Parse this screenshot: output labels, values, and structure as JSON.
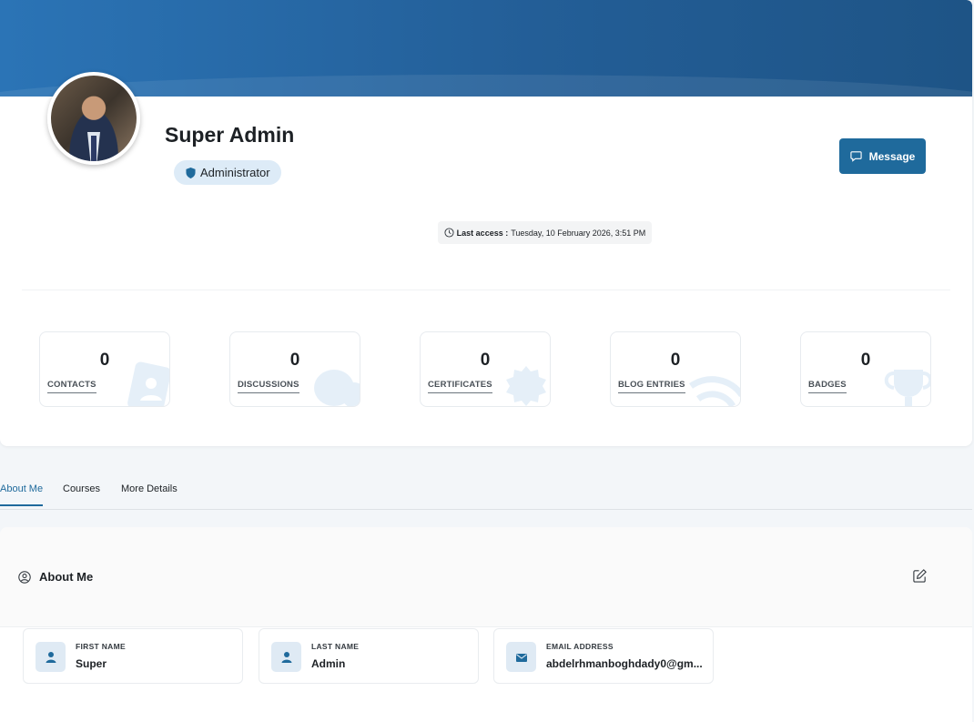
{
  "profile": {
    "name": "Super Admin",
    "role": "Administrator",
    "message_label": "Message",
    "last_access_label": "Last access :",
    "last_access_value": "Tuesday, 10 February 2026, 3:51 PM"
  },
  "stats": [
    {
      "value": "0",
      "label": "CONTACTS",
      "icon": "contacts-icon"
    },
    {
      "value": "0",
      "label": "DISCUSSIONS",
      "icon": "chat-bubbles-icon"
    },
    {
      "value": "0",
      "label": "CERTIFICATES",
      "icon": "certificate-seal-icon"
    },
    {
      "value": "0",
      "label": "BLOG ENTRIES",
      "icon": "rss-icon"
    },
    {
      "value": "0",
      "label": "BADGES",
      "icon": "trophy-icon"
    }
  ],
  "tabs": [
    {
      "label": "About Me",
      "active": true
    },
    {
      "label": "Courses",
      "active": false
    },
    {
      "label": "More Details",
      "active": false
    }
  ],
  "about": {
    "title": "About Me",
    "fields": [
      {
        "label": "FIRST NAME",
        "value": "Super",
        "icon": "user-icon"
      },
      {
        "label": "LAST NAME",
        "value": "Admin",
        "icon": "user-icon"
      },
      {
        "label": "EMAIL ADDRESS",
        "value": "abdelrhmanboghdady0@gm...",
        "icon": "envelope-icon"
      }
    ]
  },
  "colors": {
    "accent": "#1f6a9c",
    "banner": "#2b74b6",
    "badge_bg": "#ddebf7",
    "page_bg": "#f3f6f9"
  }
}
